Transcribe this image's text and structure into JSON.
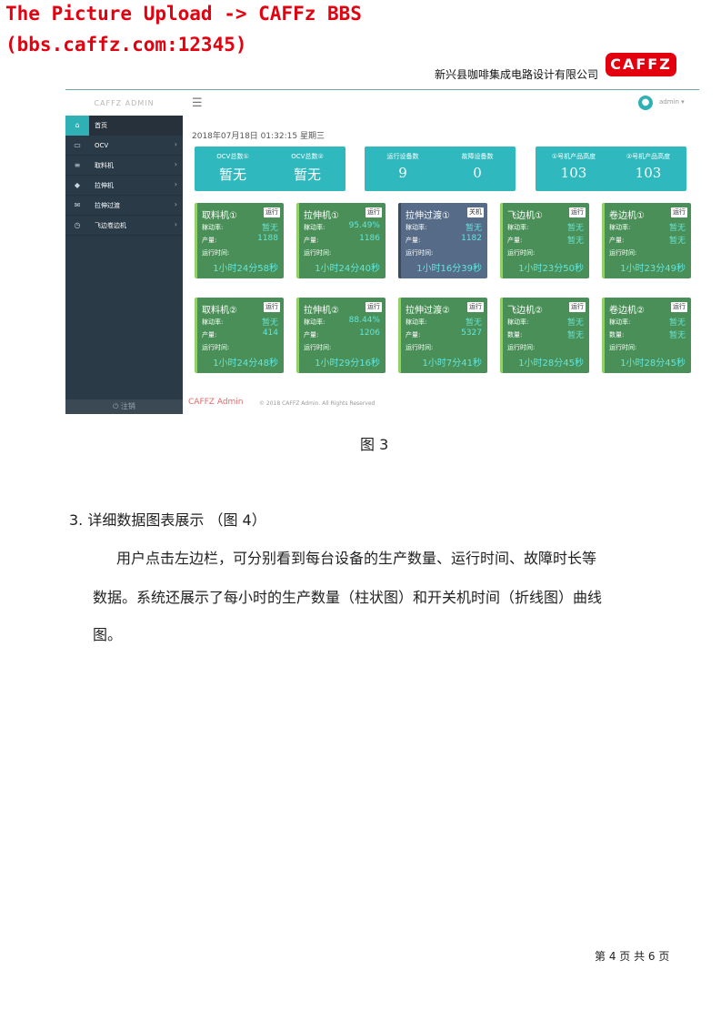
{
  "watermark": {
    "line1": "The Picture Upload ->  CAFFz BBS",
    "line2": "(bbs.caffz.com:12345)"
  },
  "header": {
    "company": "新兴县咖啡集成电路设计有限公司",
    "logo_text": "CAFFZ",
    "logo_color": "#e3000f"
  },
  "screenshot": {
    "brand": "CAFFZ ADMIN",
    "user": "admin",
    "datetime": "2018年07月18日 01:32:15 星期三",
    "sidebar": {
      "items": [
        {
          "icon": "home-icon",
          "glyph": "⌂",
          "label": "首页"
        },
        {
          "icon": "monitor-icon",
          "glyph": "▭",
          "label": "OCV"
        },
        {
          "icon": "list-icon",
          "glyph": "≡",
          "label": "取料机"
        },
        {
          "icon": "tag-icon",
          "glyph": "◆",
          "label": "拉伸机"
        },
        {
          "icon": "mail-icon",
          "glyph": "✉",
          "label": "拉伸过渡"
        },
        {
          "icon": "clock-icon",
          "glyph": "◷",
          "label": "飞边卷边机"
        }
      ],
      "footer": "⏻ 注销"
    },
    "stats": [
      {
        "label": "OCV总数①",
        "value": "暂无"
      },
      {
        "label": "OCV总数②",
        "value": "暂无"
      },
      {
        "label": "运行设备数",
        "value": "9"
      },
      {
        "label": "故障设备数",
        "value": "0"
      },
      {
        "label": "①号机产品高度",
        "value": "103"
      },
      {
        "label": "②号机产品高度",
        "value": "103"
      }
    ],
    "row_labels": {
      "rate": "稼动率:",
      "output": "产量:",
      "qty": "数量:",
      "runtime": "运行时间:"
    },
    "devices_row1": [
      {
        "name": "取料机①",
        "status": "运行",
        "rate": "暂无",
        "output": "1188",
        "time": "1小时24分58秒"
      },
      {
        "name": "拉伸机①",
        "status": "运行",
        "rate": "95.49%",
        "output": "1186",
        "time": "1小时24分40秒"
      },
      {
        "name": "拉伸过渡①",
        "status": "关机",
        "rate": "暂无",
        "output": "1182",
        "time": "1小时16分39秒"
      },
      {
        "name": "飞边机①",
        "status": "运行",
        "rate": "暂无",
        "output": "暂无",
        "time": "1小时23分50秒"
      },
      {
        "name": "卷边机①",
        "status": "运行",
        "rate": "暂无",
        "output": "暂无",
        "time": "1小时23分49秒"
      }
    ],
    "devices_row2": [
      {
        "name": "取料机②",
        "status": "运行",
        "rate": "暂无",
        "output": "414",
        "time": "1小时24分48秒"
      },
      {
        "name": "拉伸机②",
        "status": "运行",
        "rate": "88.44%",
        "output": "1206",
        "time": "1小时29分16秒"
      },
      {
        "name": "拉伸过渡②",
        "status": "运行",
        "rate": "暂无",
        "output": "5327",
        "time": "1小时7分41秒"
      },
      {
        "name": "飞边机②",
        "status": "运行",
        "rate": "暂无",
        "output": "暂无",
        "time": "1小时28分45秒"
      },
      {
        "name": "卷边机②",
        "status": "运行",
        "rate": "暂无",
        "output": "暂无",
        "time": "1小时28分45秒"
      }
    ],
    "footer_brand": "CAFFZ Admin",
    "footer_copy": "© 2018 CAFFZ Admin. All Rights Reserved"
  },
  "doc": {
    "caption": "图 3",
    "section": "3. 详细数据图表展示 （图 4）",
    "para1": "用户点击左边栏，可分别看到每台设备的生产数量、运行时间、故障时长等",
    "para2": "数据。系统还展示了每小时的生产数量（柱状图）和开关机时间（折线图）曲线",
    "para3": "图。",
    "page_number": "第 4 页 共 6 页"
  },
  "colors": {
    "sidebar": "#2a3a47",
    "stat": "#2fb8bd",
    "device_on": "#4a8f57",
    "device_off": "#566b87",
    "value_cyan": "#63e6dd"
  }
}
